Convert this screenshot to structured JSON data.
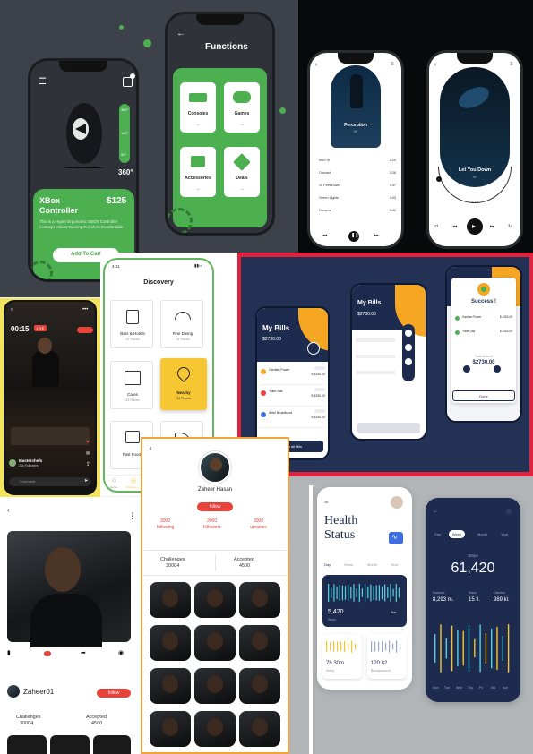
{
  "gadget": {
    "levels": {
      "top": "360°",
      "mid": "180°",
      "low": "90°"
    },
    "product_title": "XBox Controller",
    "price": "$125",
    "description": "This is a Hyper Ergonomic XBOX Controller Concept Makes Gaming For More Comfortable",
    "cart_button": "Add To Cart",
    "functions_title": "Functions",
    "functions": [
      "Consoles",
      "Games",
      "Accessories",
      "Deals"
    ]
  },
  "music": {
    "track_left": "Perception",
    "artist_left": "NF",
    "playlist": [
      {
        "title": "Intro III",
        "dur": "4:29"
      },
      {
        "title": "Outcast",
        "dur": "3:26"
      },
      {
        "title": "10 Feet Down",
        "dur": "3:37"
      },
      {
        "title": "Green Lights",
        "dur": "3:03"
      },
      {
        "title": "Dreams",
        "dur": "3:42"
      }
    ],
    "track_right": "Let You Down",
    "artist_right": "NF",
    "time_right": "2:15"
  },
  "live": {
    "time": "00:15",
    "badge": "LIVE",
    "user": "Masterchefs",
    "followers": "21k Followers",
    "comment_field": "Comment"
  },
  "discovery": {
    "status_time": "4:21",
    "title": "Discovery",
    "places": [
      {
        "name": "Bars & Hotels",
        "count": "42 Places"
      },
      {
        "name": "Fine Dining",
        "count": "15 Places"
      },
      {
        "name": "Cafes",
        "count": "28 Places"
      },
      {
        "name": "Nearby",
        "count": "34 Places"
      },
      {
        "name": "Fast Foods",
        "count": ""
      }
    ],
    "tabs": [
      "Home",
      "Discovery"
    ]
  },
  "bills": {
    "title": "My Bills",
    "amount": "$2730.00",
    "items": [
      {
        "name": "Gardian Power",
        "amount": "$ 4250.00"
      },
      {
        "name": "Toilet Gas",
        "amount": "$ 4250.00"
      },
      {
        "name": "Airtel Broadband",
        "amount": "$ 4250.00"
      }
    ],
    "pay_button": "Pay all bills",
    "success_title": "Success !",
    "total_label": "Total Amount",
    "total_amount": "$2730.00",
    "done_button": "Done"
  },
  "profile_left": {
    "user": "Zaheer01",
    "follow_button": "follow",
    "stats": [
      {
        "label": "Challenges",
        "value": "30004"
      },
      {
        "label": "Accepted",
        "value": "4500"
      }
    ]
  },
  "profile_right": {
    "name": "Zaheer Hasan",
    "follow_button": "follow",
    "counts": [
      {
        "value": "3000",
        "label": "following"
      },
      {
        "value": "3000",
        "label": "followers"
      },
      {
        "value": "3000",
        "label": "upraises"
      }
    ],
    "stats": [
      {
        "label": "Challenges",
        "value": "30004"
      },
      {
        "label": "Accepted",
        "value": "4500"
      }
    ]
  },
  "health": {
    "title_line1": "Health",
    "title_line2": "Status",
    "tabs": [
      "Day",
      "Week",
      "Month",
      "Year"
    ],
    "steps_value": "5,420",
    "steps_label": "Steps",
    "run_label": "Run",
    "sleep_value": "7h 30m",
    "sleep_label": "Sleep",
    "bp_value": "120 82",
    "bp_label": "Bloodpressure",
    "detail_tabs": [
      "Day",
      "Week",
      "Month",
      "Year"
    ],
    "detail_label": "Steps",
    "detail_value": "61,420",
    "metrics": [
      {
        "label": "Distance",
        "value": "8,293 m."
      },
      {
        "label": "Stairs",
        "value": "15 fl."
      },
      {
        "label": "Calories",
        "value": "989 kl."
      }
    ],
    "days": [
      "Mon",
      "Tue",
      "Wed",
      "Thu",
      "Fri",
      "Sat",
      "Sun"
    ]
  },
  "colors": {
    "green": "#4caf50",
    "navy": "#1d2b4f",
    "orange": "#f5a623",
    "red": "#e8423b",
    "yellow": "#f6c633"
  }
}
